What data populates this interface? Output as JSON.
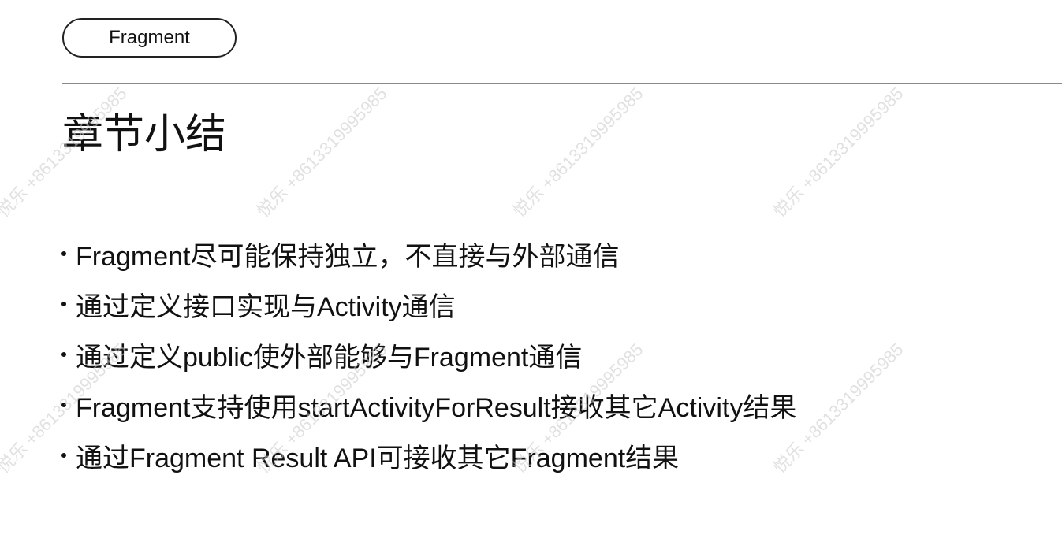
{
  "header": {
    "tag_label": "Fragment"
  },
  "page_title": "章节小结",
  "bullets": [
    "Fragment尽可能保持独立，不直接与外部通信",
    "通过定义接口实现与Activity通信",
    "通过定义public使外部能够与Fragment通信",
    "Fragment支持使用startActivityForResult接收其它Activity结果",
    "通过Fragment Result API可接收其它Fragment结果"
  ],
  "watermark": {
    "text": "悦乐 +8613319995985"
  },
  "colors": {
    "text": "#111111",
    "divider": "#8a8a8a",
    "background": "#ffffff"
  }
}
